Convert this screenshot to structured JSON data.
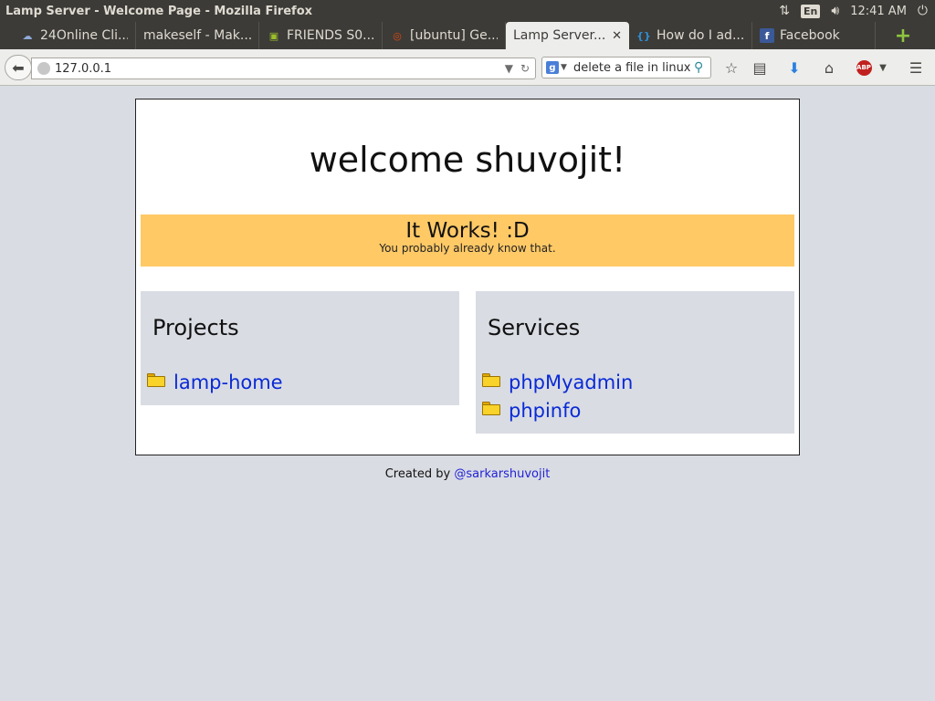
{
  "system_panel": {
    "window_title": "Lamp Server - Welcome Page - Mozilla Firefox",
    "keyboard_layout": "En",
    "clock": "12:41 AM"
  },
  "tabs": [
    {
      "label": "24Online Cli...",
      "icon": "cloud-favicon",
      "icon_color": "#8fa9d8",
      "icon_glyph": "☁",
      "active": false
    },
    {
      "label": "makeself - Mak...",
      "icon": "none",
      "icon_color": "",
      "icon_glyph": "",
      "active": false
    },
    {
      "label": "FRIENDS S0...",
      "icon": "tv-favicon",
      "icon_color": "#9bbf2b",
      "icon_glyph": "▣",
      "active": false
    },
    {
      "label": "[ubuntu] Ge...",
      "icon": "ubuntu-favicon",
      "icon_color": "#dd4814",
      "icon_glyph": "◎",
      "active": false
    },
    {
      "label": "Lamp Server...",
      "icon": "none",
      "icon_color": "",
      "icon_glyph": "",
      "active": true
    },
    {
      "label": "How do I ad...",
      "icon": "stackexchange-favicon",
      "icon_color": "#2f8fd8",
      "icon_glyph": "{}",
      "active": false
    },
    {
      "label": "Facebook",
      "icon": "facebook-favicon",
      "icon_color": "#3b5998",
      "icon_glyph": "f",
      "active": false
    }
  ],
  "toolbar": {
    "url": "127.0.0.1",
    "search_text": "delete a file in linux"
  },
  "page": {
    "welcome": "welcome shuvojit!",
    "works_title": "It Works! :D",
    "works_subtitle": "You probably already know that.",
    "projects": {
      "heading": "Projects",
      "items": [
        "lamp-home"
      ]
    },
    "services": {
      "heading": "Services",
      "items": [
        "phpMyadmin",
        "phpinfo"
      ]
    },
    "footer_prefix": "Created by",
    "footer_link": "@sarkarshuvojit"
  },
  "colors": {
    "banner": "#ffc966",
    "panel": "#d9dce3",
    "link": "#0a2ad6"
  }
}
